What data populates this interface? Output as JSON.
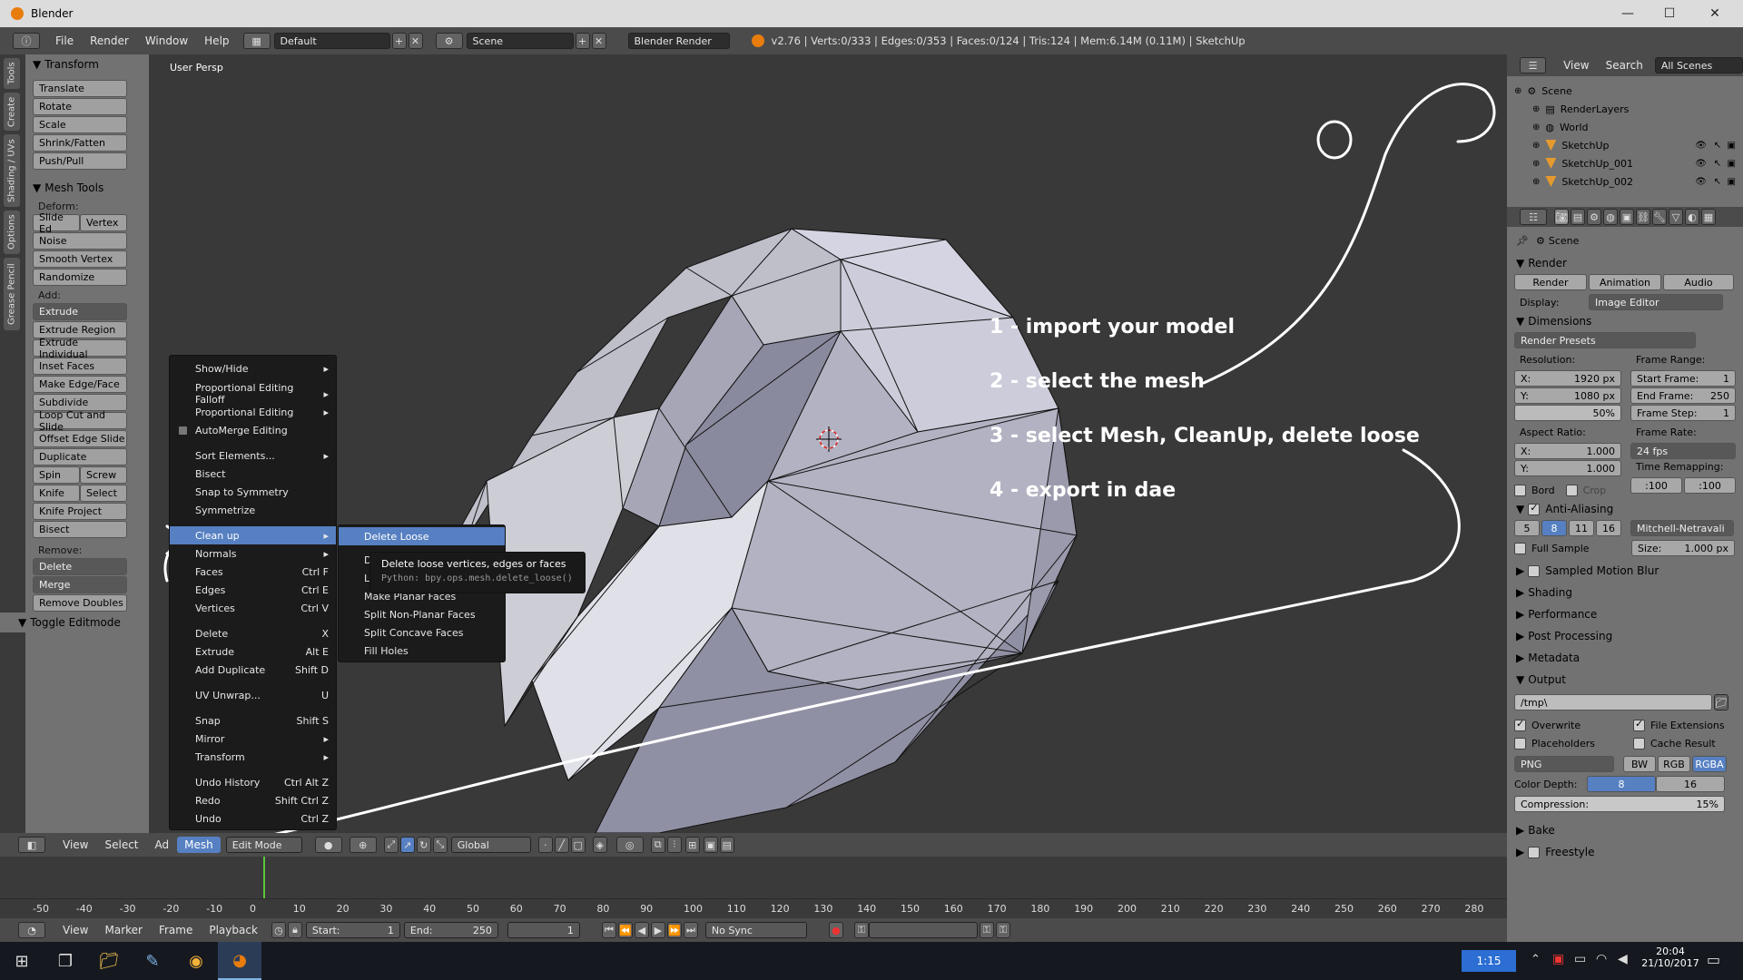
{
  "window": {
    "title": "Blender",
    "minimize": "—",
    "maximize": "☐",
    "close": "✕"
  },
  "infobar": {
    "menus": [
      "File",
      "Render",
      "Window",
      "Help"
    ],
    "layout": "Default",
    "scene": "Scene",
    "engine": "Blender Render",
    "stats": "v2.76 | Verts:0/333 | Edges:0/353 | Faces:0/124 | Tris:124 | Mem:6.14M (0.11M) | SketchUp"
  },
  "left_tabs": [
    "Tools",
    "Create",
    "Shading / UVs",
    "Options",
    "Grease Pencil"
  ],
  "toolshelf": {
    "transform_title": "Transform",
    "transform": [
      "Translate",
      "Rotate",
      "Scale",
      "Shrink/Fatten",
      "Push/Pull"
    ],
    "mesh_tools_title": "Mesh Tools",
    "deform_label": "Deform:",
    "slide_edge": "Slide Ed",
    "vertex": "Vertex",
    "deform": [
      "Noise",
      "Smooth Vertex",
      "Randomize"
    ],
    "add_label": "Add:",
    "extrude": "Extrude",
    "add": [
      "Extrude Region",
      "Extrude Individual",
      "Inset Faces",
      "Make Edge/Face",
      "Subdivide",
      "Loop Cut and Slide",
      "Offset Edge Slide",
      "Duplicate"
    ],
    "spin": "Spin",
    "screw": "Screw",
    "knife": "Knife",
    "select": "Select",
    "knife_project": "Knife Project",
    "bisect": "Bisect",
    "remove_label": "Remove:",
    "delete": "Delete",
    "merge": "Merge",
    "remove_doubles": "Remove Doubles",
    "toggle_editmode": "Toggle Editmode"
  },
  "viewport": {
    "label": "User Persp",
    "annotations": [
      "1 - import your model",
      "2 - select the mesh",
      "3 - select Mesh, CleanUp, delete loose",
      "4 - export in dae"
    ]
  },
  "mesh_menu": [
    {
      "label": "Show/Hide",
      "shortcut": "",
      "arrow": true
    },
    {
      "sep": true
    },
    {
      "label": "Proportional Editing Falloff",
      "shortcut": "",
      "arrow": true
    },
    {
      "label": "Proportional Editing",
      "shortcut": "",
      "arrow": true
    },
    {
      "label": "AutoMerge Editing",
      "shortcut": "",
      "check": true
    },
    {
      "sep": true
    },
    {
      "label": "Sort Elements...",
      "shortcut": "",
      "arrow": true
    },
    {
      "label": "Bisect",
      "shortcut": ""
    },
    {
      "label": "Snap to Symmetry",
      "shortcut": ""
    },
    {
      "label": "Symmetrize",
      "shortcut": ""
    },
    {
      "sep": true
    },
    {
      "label": "Clean up",
      "shortcut": "",
      "arrow": true,
      "hl": true
    },
    {
      "label": "Normals",
      "shortcut": "",
      "arrow": true
    },
    {
      "label": "Faces",
      "shortcut": "Ctrl F"
    },
    {
      "label": "Edges",
      "shortcut": "Ctrl E"
    },
    {
      "label": "Vertices",
      "shortcut": "Ctrl V"
    },
    {
      "sep": true
    },
    {
      "label": "Delete",
      "shortcut": "X"
    },
    {
      "label": "Extrude",
      "shortcut": "Alt E"
    },
    {
      "label": "Add Duplicate",
      "shortcut": "Shift D"
    },
    {
      "sep": true
    },
    {
      "label": "UV Unwrap...",
      "shortcut": "U"
    },
    {
      "sep": true
    },
    {
      "label": "Snap",
      "shortcut": "Shift S"
    },
    {
      "label": "Mirror",
      "shortcut": "",
      "arrow": true
    },
    {
      "label": "Transform",
      "shortcut": "",
      "arrow": true
    },
    {
      "sep": true
    },
    {
      "label": "Undo History",
      "shortcut": "Ctrl Alt Z"
    },
    {
      "label": "Redo",
      "shortcut": "Shift Ctrl Z"
    },
    {
      "label": "Undo",
      "shortcut": "Ctrl Z"
    }
  ],
  "cleanup_submenu": [
    "Delete Loose",
    "D",
    "Li",
    "Make Planar Faces",
    "Split Non-Planar Faces",
    "Split Concave Faces",
    "Fill Holes"
  ],
  "tooltip": {
    "text": "Delete loose vertices, edges or faces",
    "python": "Python: bpy.ops.mesh.delete_loose()"
  },
  "vp_header": {
    "view": "View",
    "select": "Select",
    "add": "Ad",
    "mesh": "Mesh",
    "mode": "Edit Mode",
    "orientation": "Global"
  },
  "timeline": {
    "ticks": [
      "-50",
      "-40",
      "-30",
      "-20",
      "-10",
      "0",
      "10",
      "20",
      "30",
      "40",
      "50",
      "60",
      "70",
      "80",
      "90",
      "100",
      "110",
      "120",
      "130",
      "140",
      "150",
      "160",
      "170",
      "180",
      "190",
      "200",
      "210",
      "220",
      "230",
      "240",
      "250",
      "260",
      "270",
      "280"
    ]
  },
  "tl_header": {
    "view": "View",
    "marker": "Marker",
    "frame": "Frame",
    "playback": "Playback",
    "start_label": "Start:",
    "start": "1",
    "end_label": "End:",
    "end": "250",
    "current": "1",
    "sync": "No Sync"
  },
  "outliner": {
    "view": "View",
    "search": "Search",
    "filter": "All Scenes",
    "rows": [
      {
        "label": "Scene",
        "indent": 0
      },
      {
        "label": "RenderLayers",
        "indent": 1
      },
      {
        "label": "World",
        "indent": 1
      },
      {
        "label": "SketchUp",
        "indent": 1,
        "obj": true
      },
      {
        "label": "SketchUp_001",
        "indent": 1,
        "obj": true
      },
      {
        "label": "SketchUp_002",
        "indent": 1,
        "obj": true
      }
    ]
  },
  "properties": {
    "scene": "Scene",
    "render_title": "Render",
    "render_btn": "Render",
    "animation_btn": "Animation",
    "audio_btn": "Audio",
    "display_label": "Display:",
    "display_value": "Image Editor",
    "dimensions_title": "Dimensions",
    "render_presets": "Render Presets",
    "resolution_label": "Resolution:",
    "res_x_label": "X:",
    "res_x": "1920 px",
    "res_y_label": "Y:",
    "res_y": "1080 px",
    "res_pct": "50%",
    "frame_range_label": "Frame Range:",
    "start_frame_label": "Start Frame:",
    "start_frame": "1",
    "end_frame_label": "End Frame:",
    "end_frame": "250",
    "frame_step_label": "Frame Step:",
    "frame_step": "1",
    "aspect_label": "Aspect Ratio:",
    "aspect_x_label": "X:",
    "aspect_x": "1.000",
    "aspect_y_label": "Y:",
    "aspect_y": "1.000",
    "frame_rate_label": "Frame Rate:",
    "frame_rate": "24 fps",
    "time_remap_label": "Time Remapping:",
    "time_remap_old": ":100",
    "time_remap_new": ":100",
    "bord": "Bord",
    "crop": "Crop",
    "aa_title": "Anti-Aliasing",
    "aa_samples": [
      "5",
      "8",
      "11",
      "16"
    ],
    "aa_filter": "Mitchell-Netravali",
    "full_sample": "Full Sample",
    "size_label": "Size:",
    "size": "1.000 px",
    "panels": [
      "Sampled Motion Blur",
      "Shading",
      "Performance",
      "Post Processing",
      "Metadata"
    ],
    "output_title": "Output",
    "output_path": "/tmp\\",
    "overwrite": "Overwrite",
    "file_extensions": "File Extensions",
    "placeholders": "Placeholders",
    "cache_result": "Cache Result",
    "format": "PNG",
    "bw": "BW",
    "rgb": "RGB",
    "rgba": "RGBA",
    "color_depth_label": "Color Depth:",
    "depth_8": "8",
    "depth_16": "16",
    "compression_label": "Compression:",
    "compression": "15%",
    "bake": "Bake",
    "freestyle": "Freestyle"
  },
  "taskbar": {
    "lang": "1:15",
    "time": "20:04",
    "date": "21/10/2017"
  },
  "colors": {
    "menu_highlight": "#5680c2",
    "panel": "#727272",
    "header": "#4b4b4b",
    "blender_orange": "#e87d0d"
  }
}
